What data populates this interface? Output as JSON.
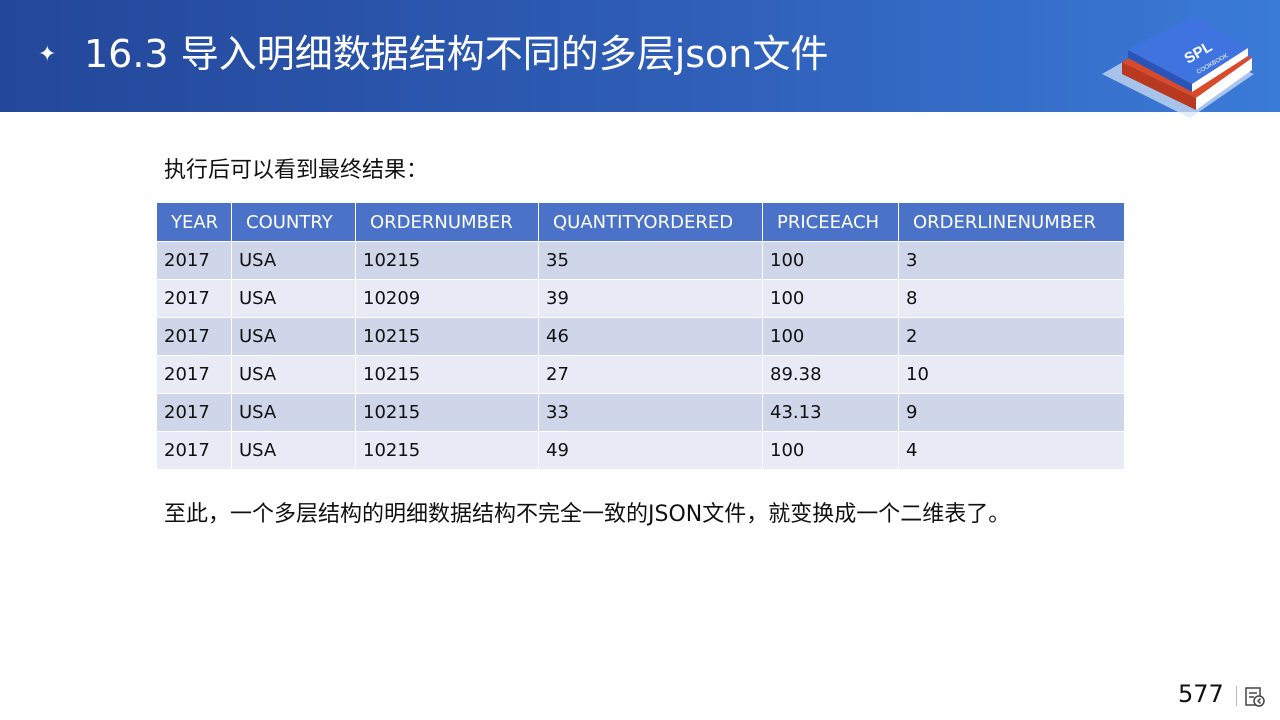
{
  "header": {
    "title": "16.3 导入明细数据结构不同的多层json文件",
    "bullet_icon": "sparkle-star-icon",
    "logo": {
      "text": "SPL",
      "subtext": "COOKBOOK",
      "icon": "book-stack-icon"
    }
  },
  "intro": "执行后可以看到最终结果：",
  "table": {
    "columns": [
      "YEAR",
      "COUNTRY",
      "ORDERNUMBER",
      "QUANTITYORDERED",
      "PRICEEACH",
      "ORDERLINENUMBER"
    ],
    "rows": [
      [
        "2017",
        "USA",
        "10215",
        "35",
        "100",
        "3"
      ],
      [
        "2017",
        "USA",
        "10209",
        "39",
        "100",
        "8"
      ],
      [
        "2017",
        "USA",
        "10215",
        "46",
        "100",
        "2"
      ],
      [
        "2017",
        "USA",
        "10215",
        "27",
        "89.38",
        "10"
      ],
      [
        "2017",
        "USA",
        "10215",
        "33",
        "43.13",
        "9"
      ],
      [
        "2017",
        "USA",
        "10215",
        "49",
        "100",
        "4"
      ]
    ]
  },
  "summary": "至此，一个多层结构的明细数据结构不完全一致的JSON文件，就变换成一个二维表了。",
  "footer": {
    "page_number": "577",
    "nav_icon": "slide-navigation-icon"
  },
  "colors": {
    "header_blue": "#23479a",
    "header_blue_light": "#3a7bd8",
    "table_header": "#4a72c9",
    "row_dark": "#cfd6ea",
    "row_light": "#e8ebf5"
  }
}
